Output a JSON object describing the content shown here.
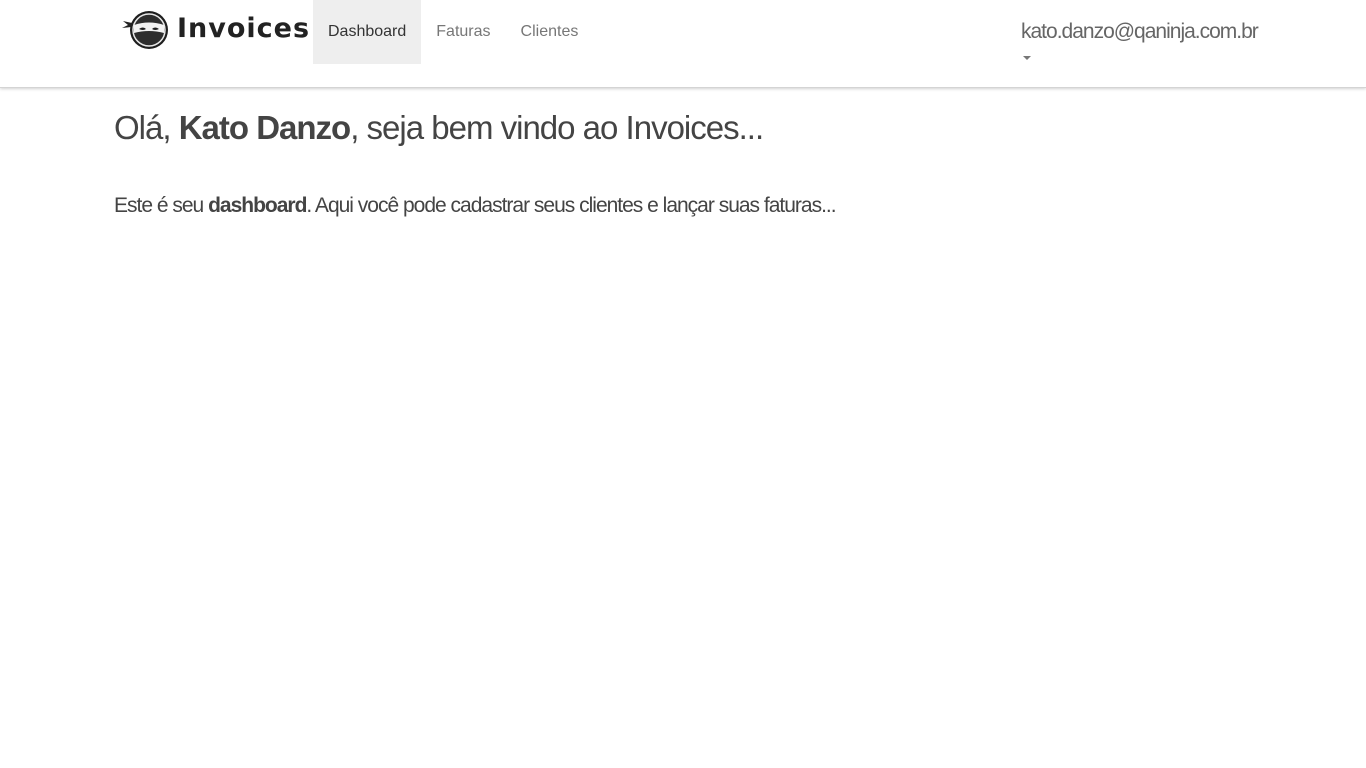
{
  "navbar": {
    "brand": "Invoices",
    "links": [
      {
        "label": "Dashboard",
        "active": true
      },
      {
        "label": "Faturas",
        "active": false
      },
      {
        "label": "Clientes",
        "active": false
      }
    ],
    "user_email": "kato.danzo@qaninja.com.br"
  },
  "main": {
    "greeting_prefix": "Olá, ",
    "user_name": "Kato Danzo",
    "greeting_suffix": ", seja bem vindo ao Invoices...",
    "lead_prefix": "Este é seu ",
    "lead_bold": "dashboard",
    "lead_suffix": ". Aqui você pode cadastrar seus clientes e lançar suas faturas..."
  },
  "icons": {
    "logo": "ninja-logo-icon",
    "dropdown": "caret-down-icon"
  },
  "colors": {
    "active_tab_bg": "#eeeeee",
    "text": "#444444",
    "nav_text": "#777777"
  }
}
